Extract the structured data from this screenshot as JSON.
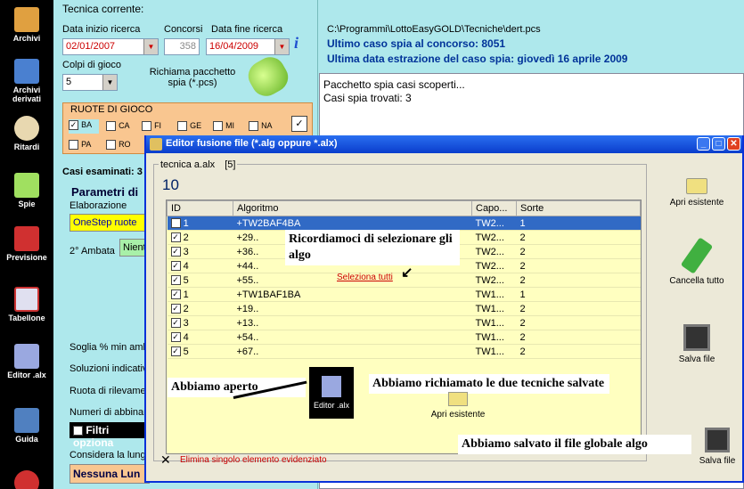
{
  "sidebar": [
    {
      "label": "Archivi"
    },
    {
      "label": "Archivi derivati"
    },
    {
      "label": "Ritardi"
    },
    {
      "label": "Spie"
    },
    {
      "label": "Previsione"
    },
    {
      "label": "Tabellone"
    },
    {
      "label": "Editor .alx"
    },
    {
      "label": "Guida"
    }
  ],
  "left": {
    "title": "Tecnica corrente:",
    "data_inizio_label": "Data inizio ricerca",
    "data_inizio": "02/01/2007",
    "concorsi_label": "Concorsi",
    "concorsi": "358",
    "data_fine_label": "Data fine ricerca",
    "data_fine": "16/04/2009",
    "colpi_label": "Colpi di gioco",
    "colpi": "5",
    "richiama_label": "Richiama pacchetto spia (*.pcs)",
    "ruote_title": "RUOTE DI GIOCO",
    "ruote_row1": [
      "BA",
      "CA",
      "FI",
      "GE",
      "MI",
      "NA"
    ],
    "ruote_row2": [
      "PA",
      "RO"
    ],
    "casi_esaminati": "Casi esaminati: 3",
    "parametri": "Parametri di",
    "elaborazione": "Elaborazione",
    "elab_value": "OneStep ruote",
    "ambata2": "2° Ambata",
    "ambata2_val": "Nient",
    "soglia": "Soglia % min amb",
    "soluzioni": "Soluzioni indicativ",
    "ruota_ril": "Ruota di rilevame",
    "numeri": "Numeri di abbinar",
    "filtri": "Filtri opziona",
    "considera": "Considera la lung",
    "nessuna": "Nessuna Lun"
  },
  "right": {
    "path": "C:\\Programmi\\LottoEasyGOLD\\Tecniche\\dert.pcs",
    "ultimo": "Ultimo caso spia al concorso:  8051",
    "ultima": "Ultima data estrazione del caso spia:  giovedì 16 aprile 2009",
    "log1": "Pacchetto spia casi scoperti...",
    "log2": "Casi spia trovati: 3"
  },
  "dialog": {
    "title": "Editor fusione file (*.alg oppure *.alx)",
    "group_label": "tecnica a.alx",
    "group_count": "[5]",
    "total": "10",
    "columns": [
      "ID",
      "Algoritmo",
      "Capo...",
      "Sorte"
    ],
    "rows": [
      {
        "id": "1",
        "alg": "+TW2BAF4BA",
        "capo": "TW2...",
        "sorte": "1"
      },
      {
        "id": "2",
        "alg": "+29..",
        "capo": "TW2...",
        "sorte": "2"
      },
      {
        "id": "3",
        "alg": "+36..",
        "capo": "TW2...",
        "sorte": "2"
      },
      {
        "id": "4",
        "alg": "+44..",
        "capo": "TW2...",
        "sorte": "2"
      },
      {
        "id": "5",
        "alg": "+55..",
        "capo": "TW2...",
        "sorte": "2"
      },
      {
        "id": "1",
        "alg": "+TW1BAF1BA",
        "capo": "TW1...",
        "sorte": "1"
      },
      {
        "id": "2",
        "alg": "+19..",
        "capo": "TW1...",
        "sorte": "2"
      },
      {
        "id": "3",
        "alg": "+13..",
        "capo": "TW1...",
        "sorte": "2"
      },
      {
        "id": "4",
        "alg": "+54..",
        "capo": "TW1...",
        "sorte": "2"
      },
      {
        "id": "5",
        "alg": "+67..",
        "capo": "TW1...",
        "sorte": "2"
      }
    ],
    "seleziona": "Seleziona tutti",
    "elimina": "Elimina singolo elemento evidenziato",
    "apri": "Apri esistente",
    "cancella": "Cancella tutto",
    "salva": "Salva file",
    "apri2": "Apri esistente",
    "editor": "Editor .alx",
    "salva2": "Salva file"
  },
  "notes": {
    "n1": "Ricordiamoci di selezionare gli algo",
    "n2": "Abbiamo aperto",
    "n3": "Abbiamo richiamato le due tecniche salvate",
    "n4": "Abbiamo salvato il file globale algo"
  }
}
